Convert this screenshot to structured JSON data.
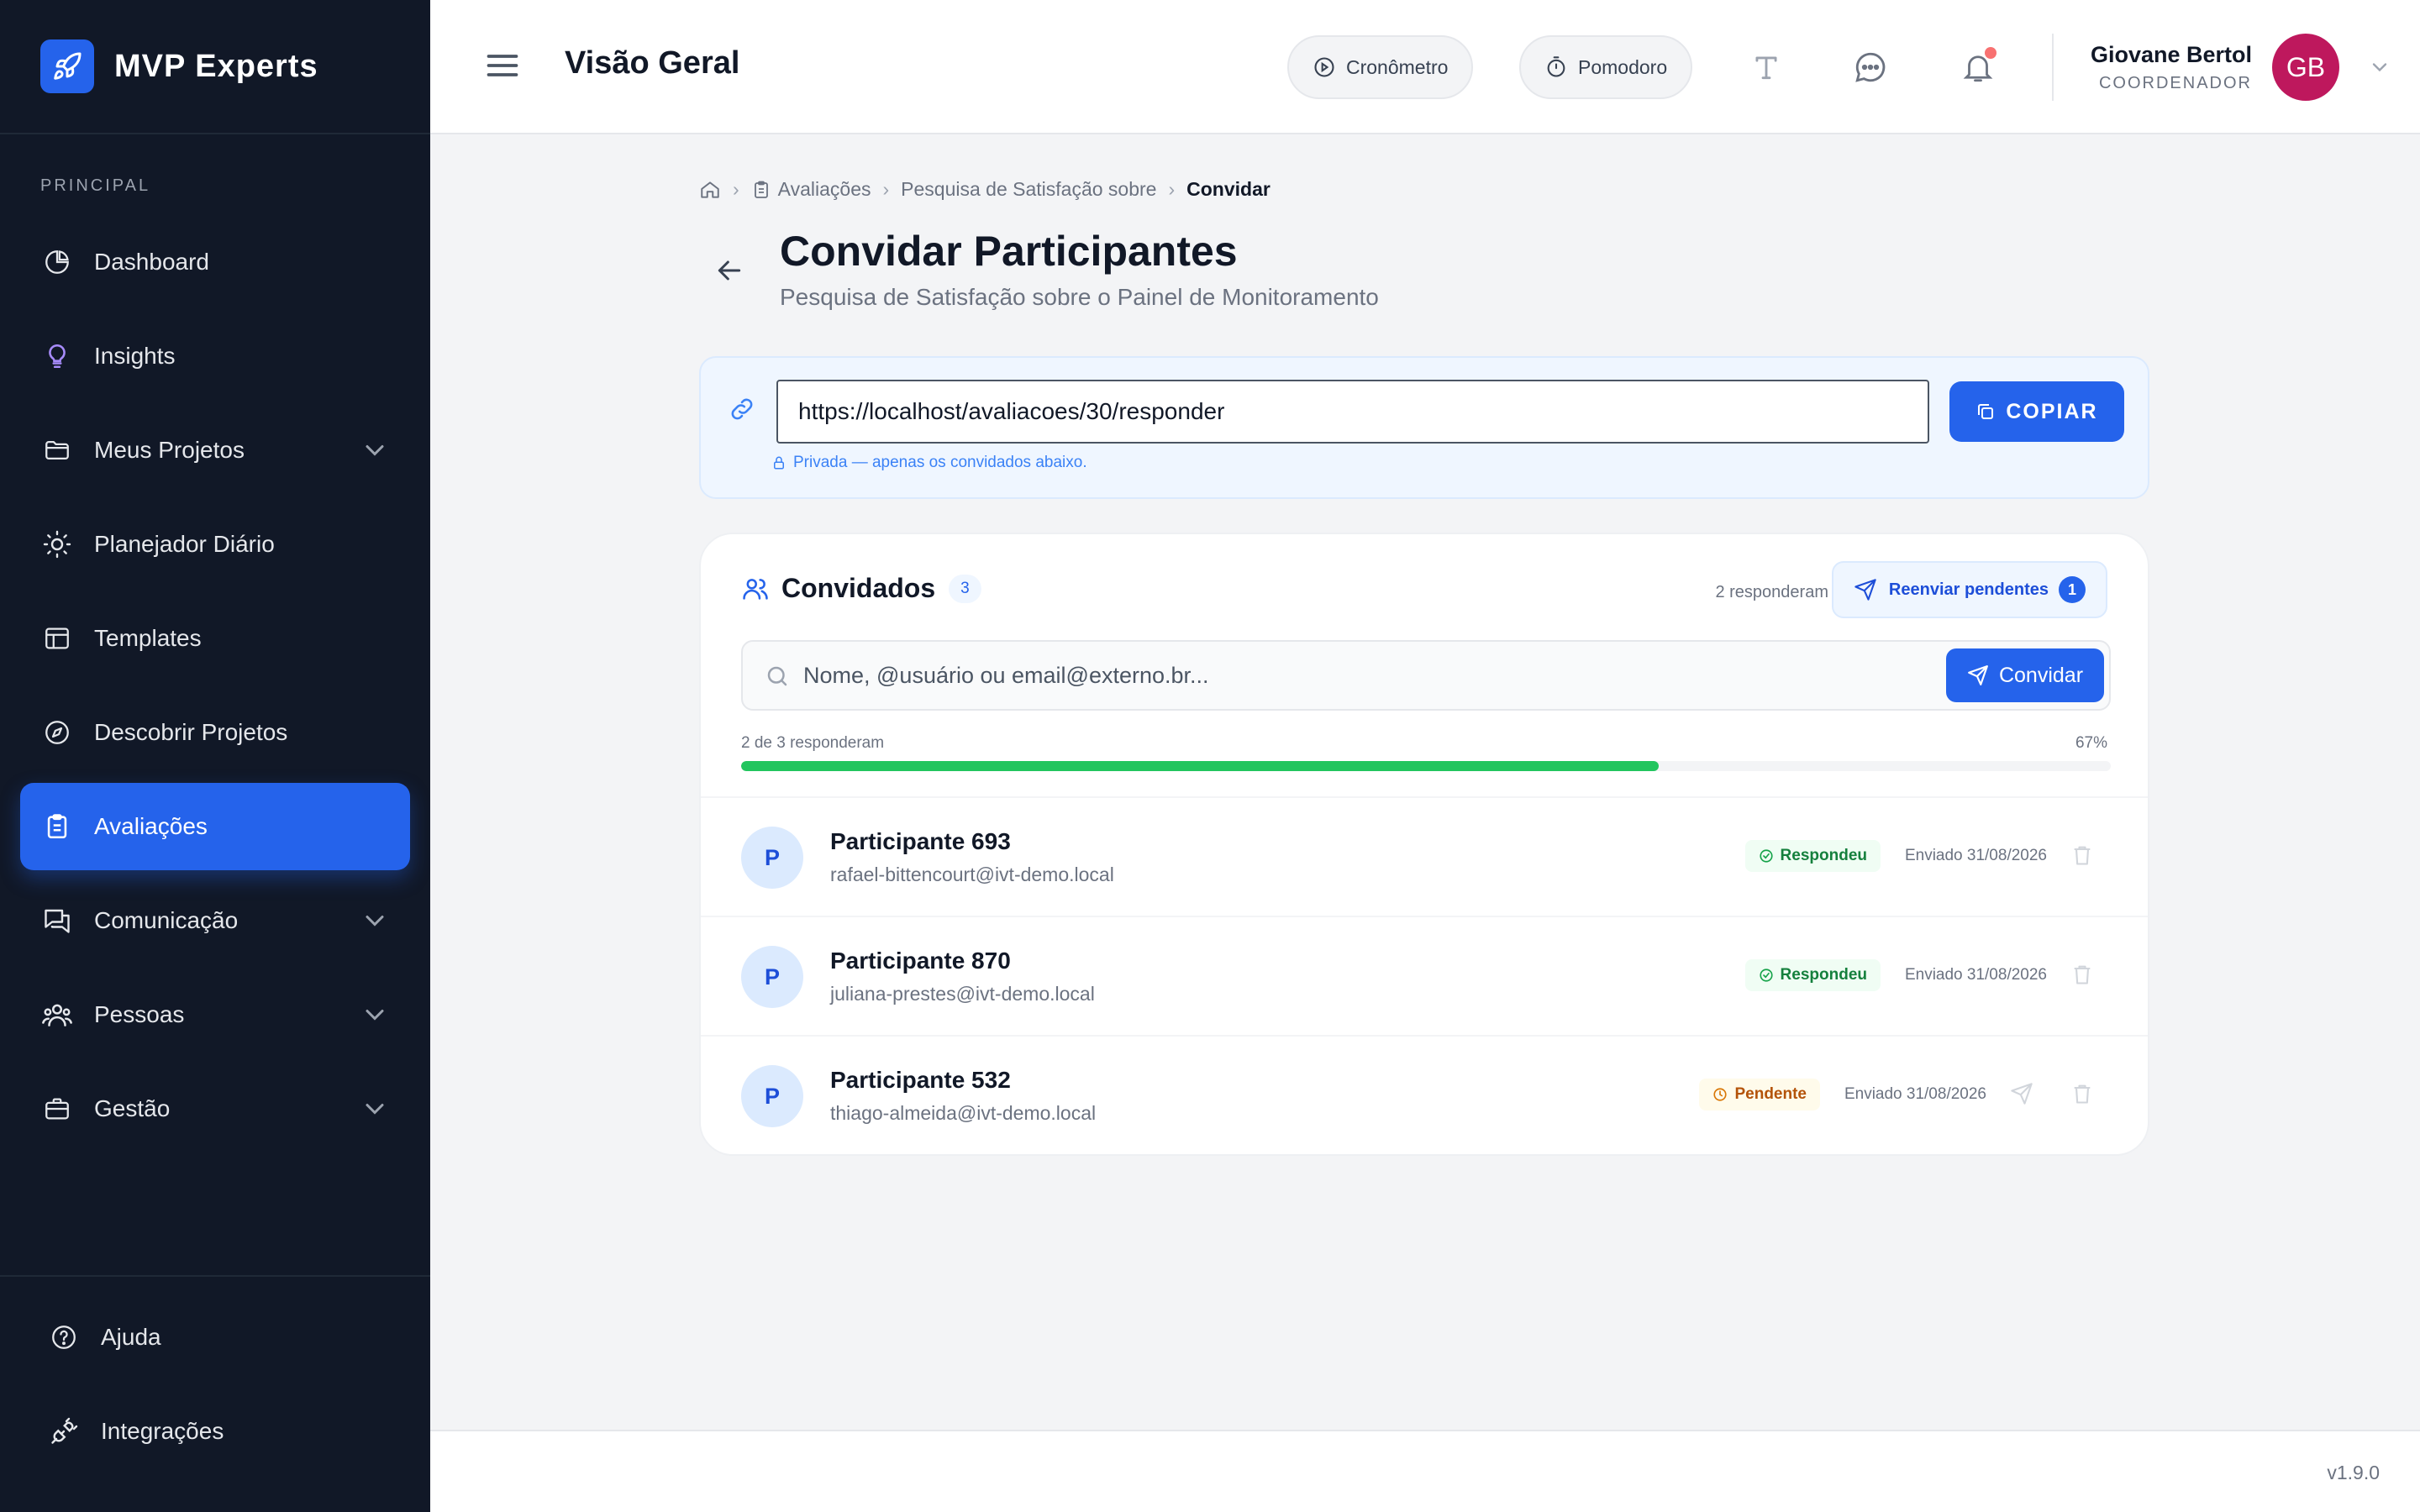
{
  "brand": {
    "name": "MVP Experts",
    "icon": "rocket-icon",
    "accent": "#2563eb"
  },
  "sidebar": {
    "section_label": "PRINCIPAL",
    "items": [
      {
        "label": "Dashboard",
        "icon": "pie-chart-icon",
        "expandable": false,
        "active": false
      },
      {
        "label": "Insights",
        "icon": "lightbulb-icon",
        "expandable": false,
        "active": false
      },
      {
        "label": "Meus Projetos",
        "icon": "folder-icon",
        "expandable": true,
        "active": false
      },
      {
        "label": "Planejador Diário",
        "icon": "sun-icon",
        "expandable": false,
        "active": false
      },
      {
        "label": "Templates",
        "icon": "layout-icon",
        "expandable": false,
        "active": false
      },
      {
        "label": "Descobrir Projetos",
        "icon": "compass-icon",
        "expandable": false,
        "active": false
      },
      {
        "label": "Avaliações",
        "icon": "clipboard-icon",
        "expandable": false,
        "active": true
      },
      {
        "label": "Comunicação",
        "icon": "chat-icon",
        "expandable": true,
        "active": false
      },
      {
        "label": "Pessoas",
        "icon": "users-icon",
        "expandable": true,
        "active": false
      },
      {
        "label": "Gestão",
        "icon": "briefcase-icon",
        "expandable": true,
        "active": false
      }
    ],
    "bottom_items": [
      {
        "label": "Ajuda",
        "icon": "help-circle-icon"
      },
      {
        "label": "Integrações",
        "icon": "plug-icon"
      }
    ]
  },
  "header": {
    "title": "Visão Geral",
    "timer_label": "Cronômetro",
    "pomodoro_label": "Pomodoro",
    "user": {
      "name": "Giovane Bertol",
      "role": "COORDENADOR",
      "initials": "GB",
      "avatar_color": "#be185d"
    }
  },
  "breadcrumb": {
    "items": [
      "Avaliações",
      "Pesquisa de Satisfação sobre"
    ],
    "current": "Convidar"
  },
  "page": {
    "title": "Convidar Participantes",
    "subtitle": "Pesquisa de Satisfação sobre o Painel de Monitoramento"
  },
  "link_card": {
    "url": "https://localhost/avaliacoes/30/responder",
    "copy_label": "COPIAR",
    "privacy_note": "Privada — apenas os convidados abaixo."
  },
  "guests": {
    "title": "Convidados",
    "count": "3",
    "responded_summary": "2 responderam",
    "resend_label": "Reenviar pendentes",
    "resend_count": "1",
    "search_placeholder": "Nome, @usuário ou email@externo.br...",
    "invite_label": "Convidar",
    "progress_label": "2 de 3 responderam",
    "progress_pct_label": "67%",
    "progress_value": 0.67,
    "progress_color": "#22c55e",
    "rows": [
      {
        "initial": "P",
        "name": "Participante 693",
        "email": "rafael-bittencourt@ivt-demo.local",
        "status": "Respondeu",
        "status_type": "ok",
        "sent": "Enviado 31/08/2026"
      },
      {
        "initial": "P",
        "name": "Participante 870",
        "email": "juliana-prestes@ivt-demo.local",
        "status": "Respondeu",
        "status_type": "ok",
        "sent": "Enviado 31/08/2026"
      },
      {
        "initial": "P",
        "name": "Participante 532",
        "email": "thiago-almeida@ivt-demo.local",
        "status": "Pendente",
        "status_type": "pend",
        "sent": "Enviado 31/08/2026"
      }
    ]
  },
  "footer": {
    "version": "v1.9.0"
  }
}
